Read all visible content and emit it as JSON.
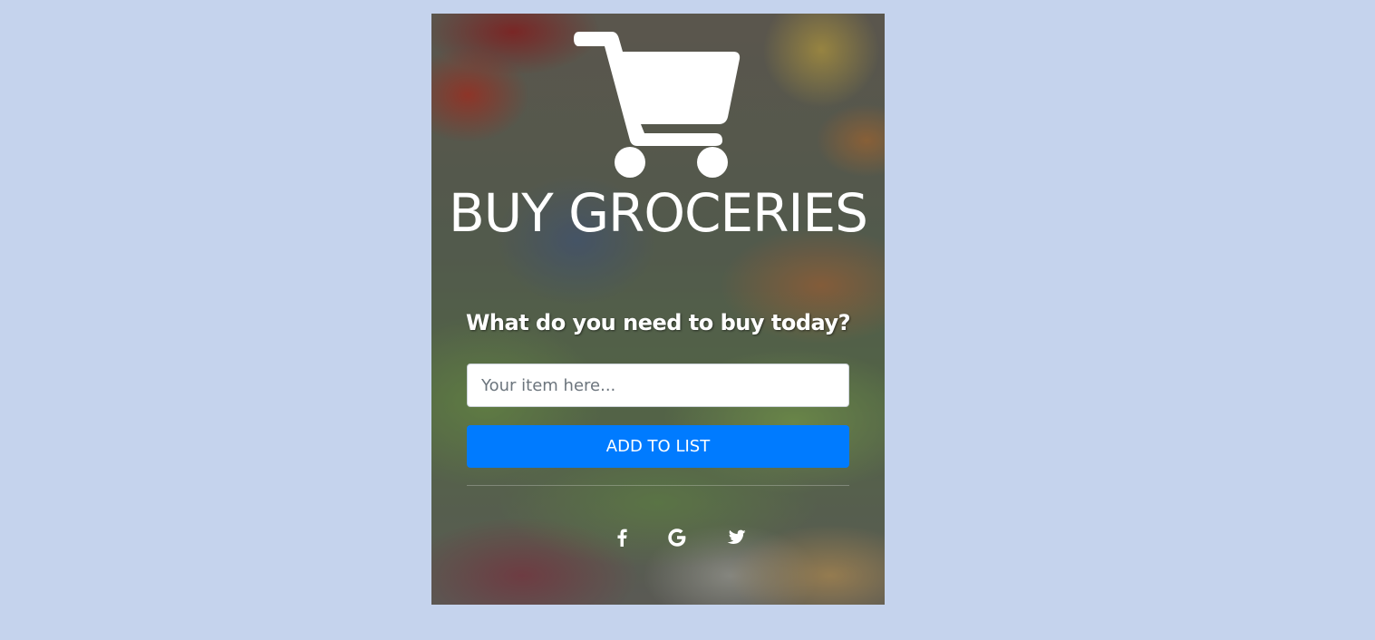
{
  "hero": {
    "icon": "shopping-cart-icon",
    "title": "BUY GROCERIES",
    "subtitle": "What do you need to buy today?"
  },
  "form": {
    "item_placeholder": "Your item here...",
    "item_value": "",
    "add_button_label": "ADD TO LIST"
  },
  "social": {
    "icons": [
      "facebook-icon",
      "google-icon",
      "twitter-icon"
    ]
  },
  "colors": {
    "page_background": "#c5d3ed",
    "button_primary": "#007bff",
    "text": "#ffffff"
  }
}
